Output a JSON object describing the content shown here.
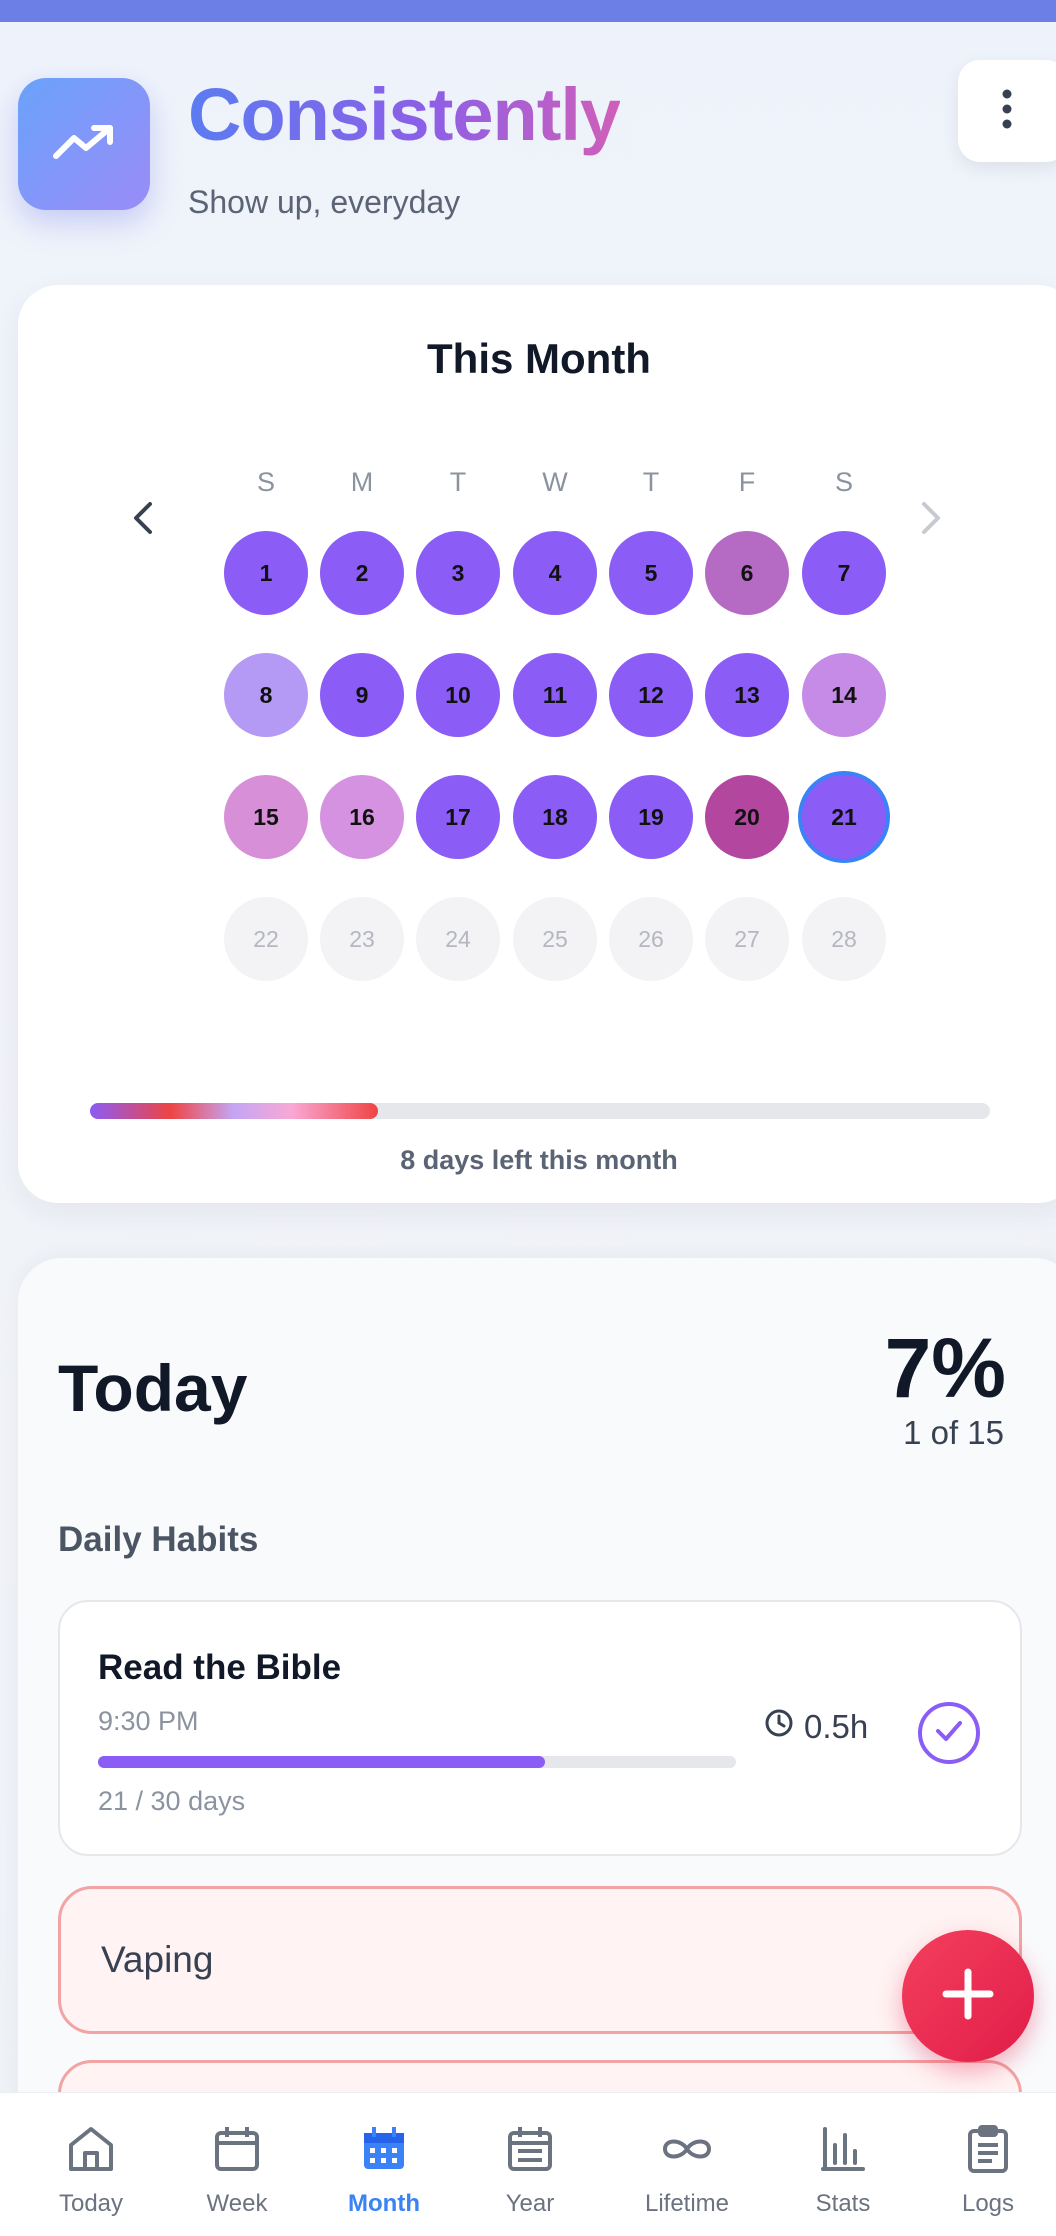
{
  "header": {
    "title": "Consistently",
    "subtitle": "Show up, everyday"
  },
  "month": {
    "title": "This Month",
    "weekdays": [
      "S",
      "M",
      "T",
      "W",
      "T",
      "F",
      "S"
    ],
    "days": [
      {
        "n": "1",
        "color": "#8b5cf6"
      },
      {
        "n": "2",
        "color": "#8b5cf6"
      },
      {
        "n": "3",
        "color": "#8b5cf6"
      },
      {
        "n": "4",
        "color": "#8b5cf6"
      },
      {
        "n": "5",
        "color": "#8b5cf6"
      },
      {
        "n": "6",
        "color": "#b56bc4"
      },
      {
        "n": "7",
        "color": "#8b5cf6"
      },
      {
        "n": "8",
        "color": "#b49af5"
      },
      {
        "n": "9",
        "color": "#8b5cf6"
      },
      {
        "n": "10",
        "color": "#8b5cf6"
      },
      {
        "n": "11",
        "color": "#8b5cf6"
      },
      {
        "n": "12",
        "color": "#8b5cf6"
      },
      {
        "n": "13",
        "color": "#8b5cf6"
      },
      {
        "n": "14",
        "color": "#c58be6"
      },
      {
        "n": "15",
        "color": "#d78fd7"
      },
      {
        "n": "16",
        "color": "#d592e0"
      },
      {
        "n": "17",
        "color": "#8b5cf6"
      },
      {
        "n": "18",
        "color": "#8b5cf6"
      },
      {
        "n": "19",
        "color": "#8b5cf6"
      },
      {
        "n": "20",
        "color": "#b3479f"
      },
      {
        "n": "21",
        "color": "#8b5cf6",
        "today": true
      },
      {
        "n": "22",
        "future": true
      },
      {
        "n": "23",
        "future": true
      },
      {
        "n": "24",
        "future": true
      },
      {
        "n": "25",
        "future": true
      },
      {
        "n": "26",
        "future": true
      },
      {
        "n": "27",
        "future": true
      },
      {
        "n": "28",
        "future": true
      }
    ],
    "progress_fraction": 0.32,
    "footer": "8 days left this month"
  },
  "today": {
    "title": "Today",
    "percent": "7%",
    "count": "1 of 15",
    "section_label": "Daily Habits",
    "habits": [
      {
        "name": "Read the Bible",
        "time": "9:30 PM",
        "progress_fraction": 0.7,
        "days": "21 / 30 days",
        "duration": "0.5h"
      }
    ],
    "vices": [
      {
        "name": "Vaping"
      }
    ]
  },
  "nav": [
    {
      "label": "Today",
      "icon": "home-icon"
    },
    {
      "label": "Week",
      "icon": "calendar-icon"
    },
    {
      "label": "Month",
      "icon": "calendar-grid-icon",
      "active": true
    },
    {
      "label": "Year",
      "icon": "calendar-list-icon"
    },
    {
      "label": "Lifetime",
      "icon": "infinity-icon"
    },
    {
      "label": "Stats",
      "icon": "bar-chart-icon"
    },
    {
      "label": "Logs",
      "icon": "clipboard-icon"
    }
  ],
  "colors": {
    "accent": "#3b82f6",
    "purple": "#8b5cf6",
    "fab": "#f43f5e"
  }
}
